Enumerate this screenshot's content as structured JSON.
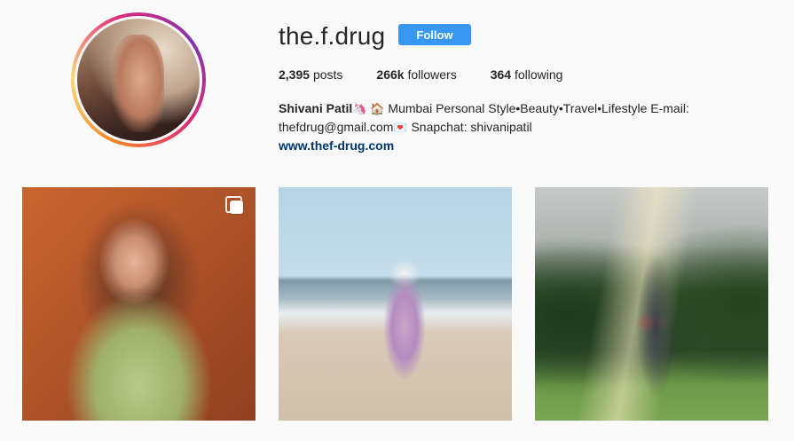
{
  "profile": {
    "username": "the.f.drug",
    "follow_label": "Follow",
    "stats": {
      "posts_count": "2,395",
      "posts_label": "posts",
      "followers_count": "266k",
      "followers_label": "followers",
      "following_count": "364",
      "following_label": "following"
    },
    "bio": {
      "name": "Shivani Patil",
      "name_emoji": "🦄",
      "location_emoji": "🏠",
      "line1_text": "Mumbai Personal Style•Beauty•Travel•Lifestyle E-mail:",
      "line2_text": "thefdrug@gmail.com",
      "mail_emoji": "💌",
      "line2_rest": "Snapchat: shivanipatil",
      "website": "www.thef-drug.com"
    },
    "avatar_icon": "profile-photo",
    "colors": {
      "follow_button": "#3897f0",
      "link": "#003569",
      "background": "#fafafa"
    }
  },
  "posts": [
    {
      "icon": "multiple-photos-icon"
    },
    {},
    {}
  ]
}
